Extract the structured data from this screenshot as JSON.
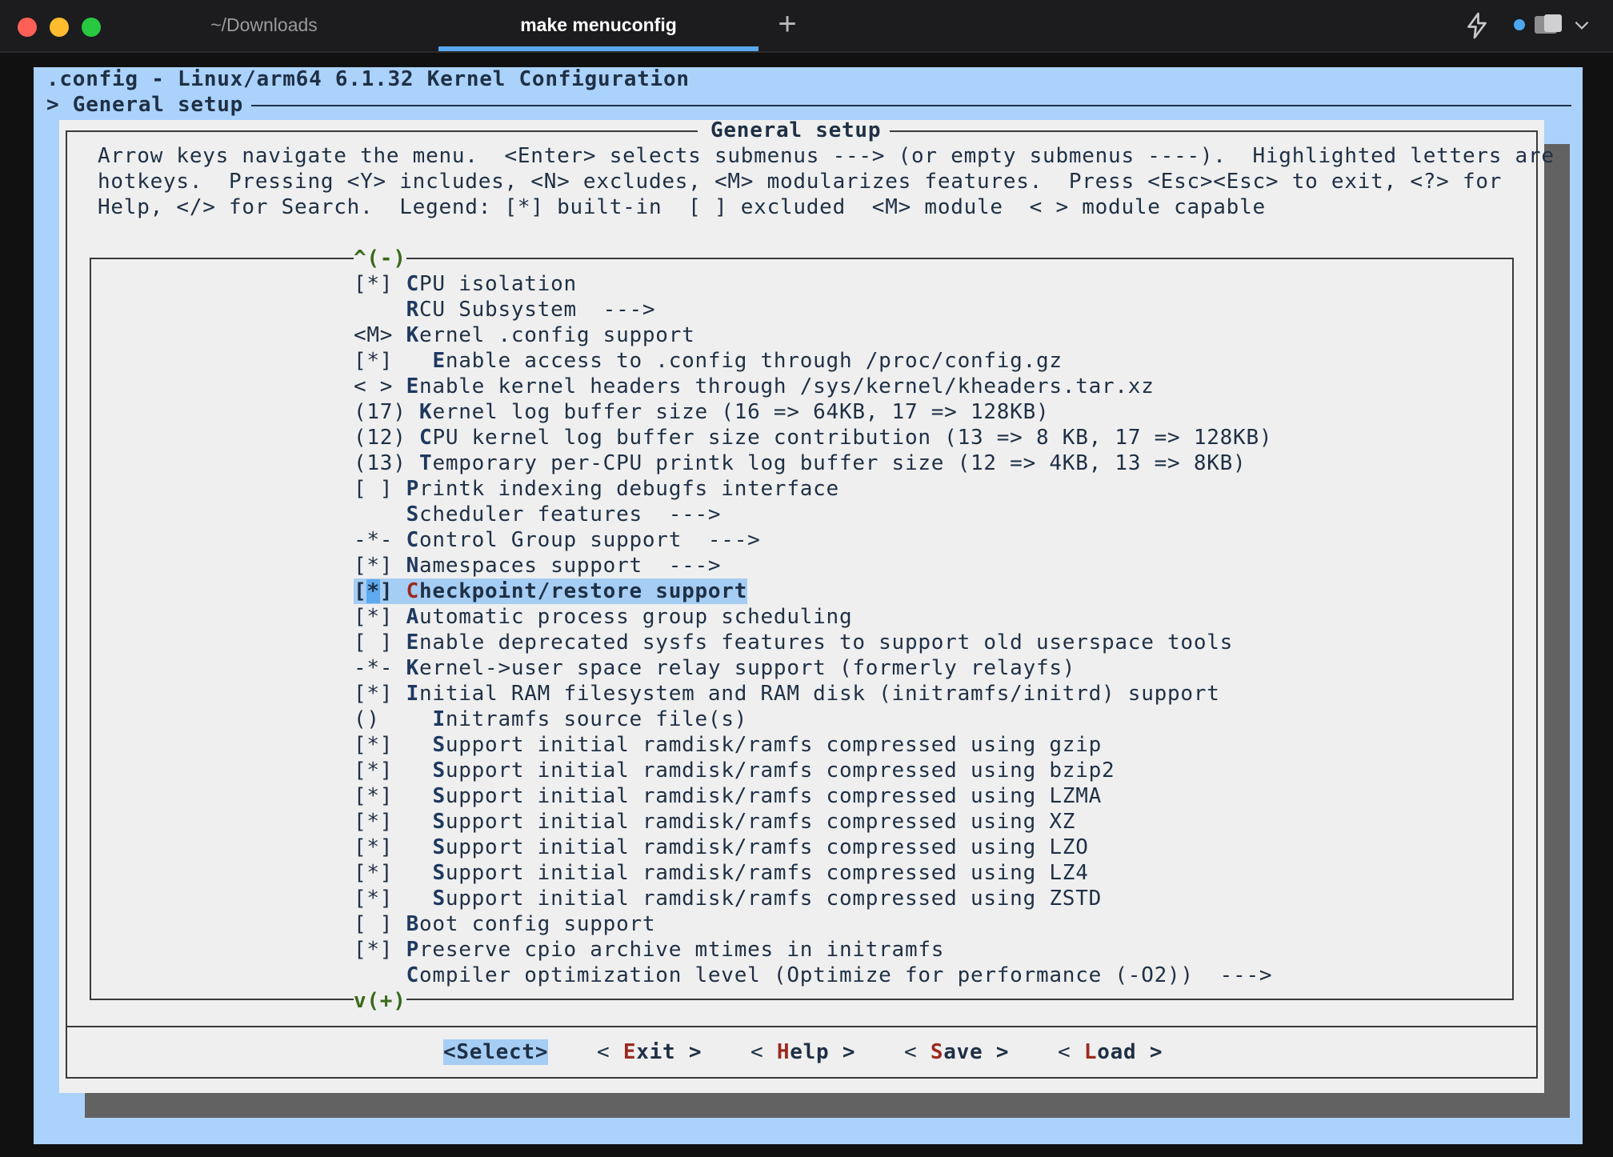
{
  "tabs": {
    "inactive_label": "~/Downloads",
    "active_label": "make menuconfig",
    "new_tab": "+"
  },
  "terminal": {
    "header_line": ".config - Linux/arm64 6.1.32 Kernel Configuration",
    "breadcrumb": "> General setup",
    "dialog_title": "General setup",
    "help_lines": [
      "Arrow keys navigate the menu.  <Enter> selects submenus ---> (or empty submenus ----).  Highlighted letters are",
      "hotkeys.  Pressing <Y> includes, <N> excludes, <M> modularizes features.  Press <Esc><Esc> to exit, <?> for",
      "Help, </> for Search.  Legend: [*] built-in  [ ] excluded  <M> module  < > module capable"
    ],
    "scroll_up": "^(-)",
    "scroll_down": "v(+)",
    "menu_items": [
      {
        "state": "[*]",
        "indent": " ",
        "hotkey": "C",
        "rest": "PU isolation"
      },
      {
        "state": "   ",
        "indent": " ",
        "hotkey": "R",
        "rest": "CU Subsystem  --->"
      },
      {
        "state": "<M>",
        "indent": " ",
        "hotkey": "K",
        "rest": "ernel .config support"
      },
      {
        "state": "[*]",
        "indent": "   ",
        "hotkey": "E",
        "rest": "nable access to .config through /proc/config.gz"
      },
      {
        "state": "< >",
        "indent": " ",
        "hotkey": "E",
        "rest": "nable kernel headers through /sys/kernel/kheaders.tar.xz"
      },
      {
        "state": "(17)",
        "indent": " ",
        "hotkey": "K",
        "rest": "ernel log buffer size (16 => 64KB, 17 => 128KB)"
      },
      {
        "state": "(12)",
        "indent": " ",
        "hotkey": "C",
        "rest": "PU kernel log buffer size contribution (13 => 8 KB, 17 => 128KB)"
      },
      {
        "state": "(13)",
        "indent": " ",
        "hotkey": "T",
        "rest": "emporary per-CPU printk log buffer size (12 => 4KB, 13 => 8KB)"
      },
      {
        "state": "[ ]",
        "indent": " ",
        "hotkey": "P",
        "rest": "rintk indexing debugfs interface"
      },
      {
        "state": "   ",
        "indent": " ",
        "hotkey": "S",
        "rest": "cheduler features  --->"
      },
      {
        "state": "-*-",
        "indent": " ",
        "hotkey": "C",
        "rest": "ontrol Group support  --->"
      },
      {
        "state": "[*]",
        "indent": " ",
        "hotkey": "N",
        "rest": "amespaces support  --->"
      },
      {
        "state": "[*]",
        "indent": " ",
        "hotkey": "C",
        "rest": "heckpoint/restore support",
        "selected": true
      },
      {
        "state": "[*]",
        "indent": " ",
        "hotkey": "A",
        "rest": "utomatic process group scheduling"
      },
      {
        "state": "[ ]",
        "indent": " ",
        "hotkey": "E",
        "rest": "nable deprecated sysfs features to support old userspace tools"
      },
      {
        "state": "-*-",
        "indent": " ",
        "hotkey": "K",
        "rest": "ernel->user space relay support (formerly relayfs)"
      },
      {
        "state": "[*]",
        "indent": " ",
        "hotkey": "I",
        "rest": "nitial RAM filesystem and RAM disk (initramfs/initrd) support"
      },
      {
        "state": "() ",
        "indent": "   ",
        "hotkey": "I",
        "rest": "nitramfs source file(s)"
      },
      {
        "state": "[*]",
        "indent": "   ",
        "hotkey": "S",
        "rest": "upport initial ramdisk/ramfs compressed using gzip"
      },
      {
        "state": "[*]",
        "indent": "   ",
        "hotkey": "S",
        "rest": "upport initial ramdisk/ramfs compressed using bzip2"
      },
      {
        "state": "[*]",
        "indent": "   ",
        "hotkey": "S",
        "rest": "upport initial ramdisk/ramfs compressed using LZMA"
      },
      {
        "state": "[*]",
        "indent": "   ",
        "hotkey": "S",
        "rest": "upport initial ramdisk/ramfs compressed using XZ"
      },
      {
        "state": "[*]",
        "indent": "   ",
        "hotkey": "S",
        "rest": "upport initial ramdisk/ramfs compressed using LZO"
      },
      {
        "state": "[*]",
        "indent": "   ",
        "hotkey": "S",
        "rest": "upport initial ramdisk/ramfs compressed using LZ4"
      },
      {
        "state": "[*]",
        "indent": "   ",
        "hotkey": "S",
        "rest": "upport initial ramdisk/ramfs compressed using ZSTD"
      },
      {
        "state": "[ ]",
        "indent": " ",
        "hotkey": "B",
        "rest": "oot config support"
      },
      {
        "state": "[*]",
        "indent": " ",
        "hotkey": "P",
        "rest": "reserve cpio archive mtimes in initramfs"
      },
      {
        "state": "   ",
        "indent": " ",
        "hotkey": "C",
        "rest": "ompiler optimization level (Optimize for performance (-O2))  --->"
      }
    ],
    "buttons": {
      "select": "<Select>",
      "exit_l": "< ",
      "exit_hk": "E",
      "exit_r": "xit >",
      "help_l": "< ",
      "help_hk": "H",
      "help_r": "elp >",
      "save_l": "< ",
      "save_hk": "S",
      "save_r": "ave >",
      "load_l": "< ",
      "load_hk": "L",
      "load_r": "oad >"
    }
  },
  "colors": {
    "screen_bg": "#abd2fb",
    "dialog_bg": "#efefef",
    "text": "#1f3045",
    "selection": "#a6cdf4",
    "cursor": "#5fa9ee",
    "hotkey_red": "#9b2a1f",
    "tab_accent": "#5aa8f0"
  },
  "icons": [
    "close-light",
    "minimize-light",
    "zoom-light",
    "plus-icon",
    "bolt-icon",
    "status-dot-icon",
    "window-icon",
    "chevron-down-icon"
  ]
}
